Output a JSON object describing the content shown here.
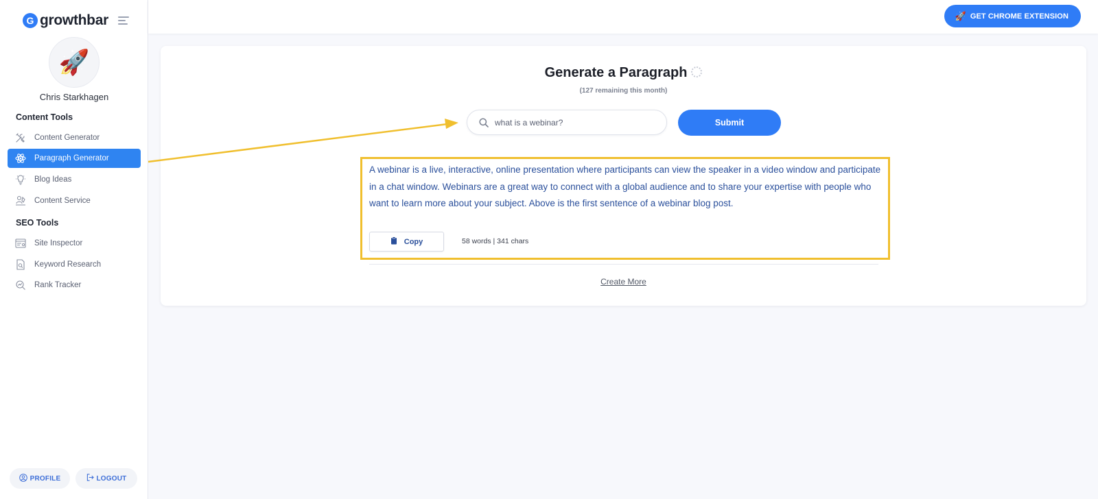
{
  "app": {
    "brand_name": "growthbar",
    "brand_logo_letter": "G",
    "accent_color": "#2f7cf6",
    "highlight_color": "#f0bf2e"
  },
  "sidebar": {
    "user_name": "Chris Starkhagen",
    "avatar_icon": "rocket-emoji",
    "sections": [
      {
        "title": "Content Tools"
      },
      {
        "title": "SEO Tools"
      }
    ],
    "items": [
      {
        "label": "Content Generator",
        "icon": "tools-icon",
        "active": false
      },
      {
        "label": "Paragraph Generator",
        "icon": "atom-icon",
        "active": true
      },
      {
        "label": "Blog Ideas",
        "icon": "lightbulb-icon",
        "active": false
      },
      {
        "label": "Content Service",
        "icon": "writer-icon",
        "active": false
      },
      {
        "label": "Site Inspector",
        "icon": "browser-icon",
        "active": false
      },
      {
        "label": "Keyword Research",
        "icon": "document-search-icon",
        "active": false
      },
      {
        "label": "Rank Tracker",
        "icon": "chart-search-icon",
        "active": false
      }
    ],
    "profile_label": "PROFILE",
    "logout_label": "LOGOUT"
  },
  "header": {
    "chrome_extension_label": "GET CHROME EXTENSION"
  },
  "main": {
    "title": "Generate a Paragraph",
    "remaining": "(127 remaining this month)",
    "search": {
      "value": "what is a webinar?",
      "placeholder": ""
    },
    "submit_label": "Submit",
    "result": {
      "text": "A webinar is a live, interactive, online presentation where participants can view the speaker in a video window and participate in a chat window. Webinars are a great way to connect with a global audience and to share your expertise with people who want to learn more about your subject. Above is the first sentence of a webinar blog post.",
      "copy_label": "Copy",
      "count": "58 words | 341 chars"
    },
    "create_more_label": "Create More"
  }
}
